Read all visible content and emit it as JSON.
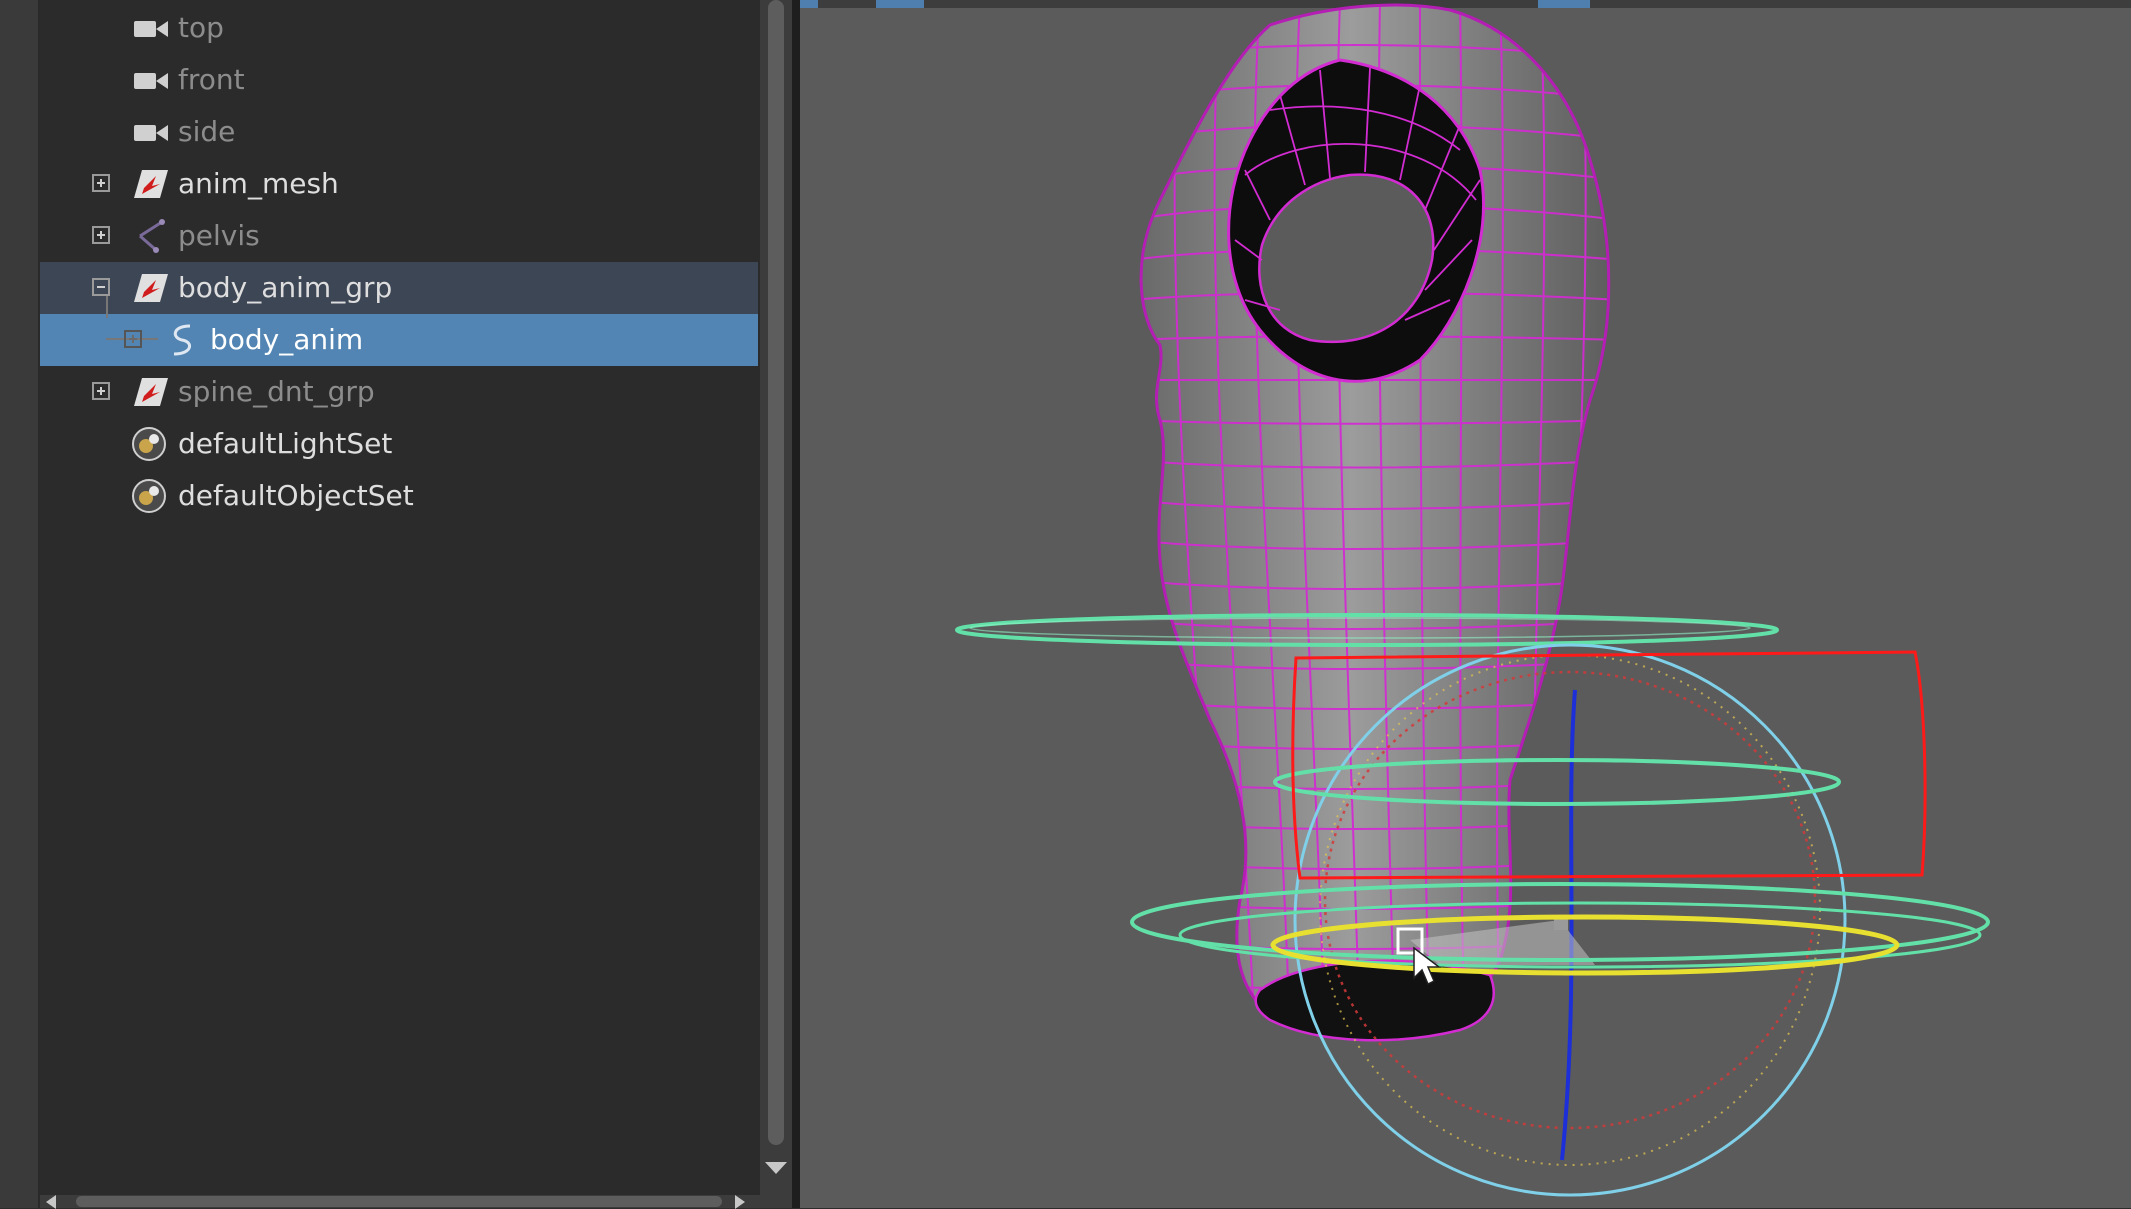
{
  "outliner": {
    "items": [
      {
        "label": "top",
        "icon": "camera-icon",
        "expander": "none",
        "state": "dim"
      },
      {
        "label": "front",
        "icon": "camera-icon",
        "expander": "none",
        "state": "dim"
      },
      {
        "label": "side",
        "icon": "camera-icon",
        "expander": "none",
        "state": "dim"
      },
      {
        "label": "anim_mesh",
        "icon": "transform-group-icon",
        "expander": "plus",
        "state": "normal"
      },
      {
        "label": "pelvis",
        "icon": "joint-icon",
        "expander": "plus",
        "state": "dim"
      },
      {
        "label": "body_anim_grp",
        "icon": "transform-group-icon",
        "expander": "minus",
        "state": "parent-of-selected"
      },
      {
        "label": "body_anim",
        "icon": "nurbs-curve-icon",
        "expander": "plus",
        "state": "selected"
      },
      {
        "label": "spine_dnt_grp",
        "icon": "transform-group-icon",
        "expander": "plus",
        "state": "dim"
      },
      {
        "label": "defaultLightSet",
        "icon": "object-set-icon",
        "expander": "none",
        "state": "normal"
      },
      {
        "label": "defaultObjectSet",
        "icon": "object-set-icon",
        "expander": "none",
        "state": "normal"
      }
    ]
  },
  "viewport": {
    "mesh_wire_color": "#d22cd2",
    "selection_box_color": "#ff1a1a",
    "control_ring_color": "#62e0a8",
    "active_ring_color": "#e8e030",
    "rotate_sphere_color": "#7fd0e8",
    "axis_y_color": "#1c2fd8",
    "background_color": "#5b5b5b"
  },
  "colors": {
    "outliner_bg": "#2b2b2b",
    "selection_highlight": "#5285b3",
    "parent_highlight": "#3d4655"
  }
}
